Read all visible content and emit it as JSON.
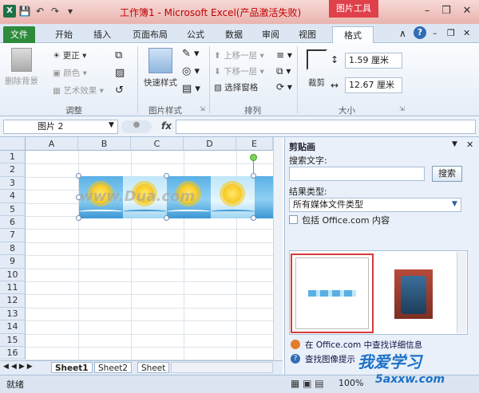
{
  "window": {
    "title": "工作簿1 - Microsoft Excel(产品激活失败)",
    "context_tab": "图片工具"
  },
  "tabs": [
    "文件",
    "开始",
    "插入",
    "页面布局",
    "公式",
    "数据",
    "审阅",
    "视图",
    "格式"
  ],
  "ribbon": {
    "adjust": {
      "remove_bg": "删除背景",
      "corrections": "更正",
      "color": "颜色",
      "artistic": "艺术效果",
      "label": "调整"
    },
    "picture_styles": {
      "quick_styles": "快速样式",
      "label": "图片样式"
    },
    "arrange": {
      "bring_forward": "上移一层",
      "send_backward": "下移一层",
      "selection_pane": "选择窗格",
      "label": "排列"
    },
    "size": {
      "crop": "裁剪",
      "height": "1.59 厘米",
      "width": "12.67 厘米",
      "label": "大小"
    }
  },
  "formula_bar": {
    "name_box": "图片 2",
    "fx": "fx"
  },
  "sheet": {
    "columns": [
      "A",
      "B",
      "C",
      "D",
      "E"
    ],
    "rows": [
      "1",
      "2",
      "3",
      "4",
      "5",
      "6",
      "7",
      "8",
      "9",
      "10",
      "11",
      "12",
      "13",
      "14",
      "15",
      "16"
    ],
    "watermark": "www.Dua.com",
    "tabs": [
      "Sheet1",
      "Sheet2",
      "Sheet"
    ]
  },
  "clipart_pane": {
    "title": "剪贴画",
    "search_label": "搜索文字:",
    "search_value": "",
    "search_button": "搜索",
    "results_label": "结果类型:",
    "results_type": "所有媒体文件类型",
    "include_office": "包括 Office.com 内容",
    "find_more": "在 Office.com 中查找详细信息",
    "find_tips": "查找图像提示"
  },
  "status": {
    "ready": "就绪",
    "zoom": "100%"
  },
  "watermark": {
    "brand": "我爱学习",
    "site": "5axxw.com"
  }
}
